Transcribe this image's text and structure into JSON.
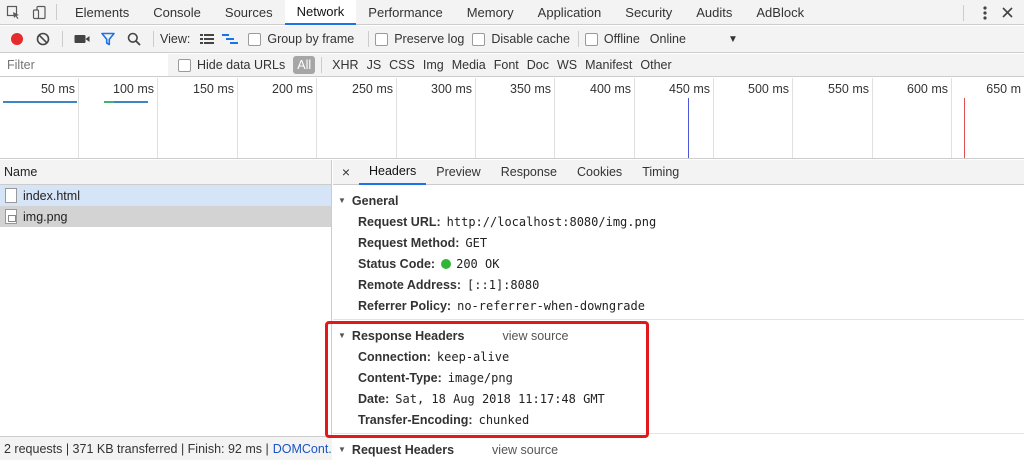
{
  "tabbar": {
    "tabs": [
      "Elements",
      "Console",
      "Sources",
      "Network",
      "Performance",
      "Memory",
      "Application",
      "Security",
      "Audits",
      "AdBlock"
    ],
    "active": "Network"
  },
  "toolbar": {
    "view_label": "View:",
    "group_by_frame": "Group by frame",
    "preserve_log": "Preserve log",
    "disable_cache": "Disable cache",
    "offline": "Offline",
    "throttle_value": "Online",
    "record_color": "#e52b2b",
    "filter_active_color": "#1a73e8"
  },
  "filter": {
    "placeholder": "Filter",
    "hide_data_urls": "Hide data URLs",
    "types": [
      "All",
      "XHR",
      "JS",
      "CSS",
      "Img",
      "Media",
      "Font",
      "Doc",
      "WS",
      "Manifest",
      "Other"
    ]
  },
  "overview": {
    "ticks": [
      "50 ms",
      "100 ms",
      "150 ms",
      "200 ms",
      "250 ms",
      "300 ms",
      "350 ms",
      "400 ms",
      "450 ms",
      "500 ms",
      "550 ms",
      "600 ms",
      "650 m"
    ]
  },
  "requests": {
    "header": "Name",
    "items": [
      "index.html",
      "img.png"
    ],
    "status_text": "2 requests | 371 KB transferred | Finish: 92 ms |",
    "status_link": "DOMCont..."
  },
  "details": {
    "tabs": [
      "Headers",
      "Preview",
      "Response",
      "Cookies",
      "Timing"
    ],
    "close_glyph": "×",
    "general": {
      "title": "General",
      "rows": [
        {
          "k": "Request URL:",
          "v": "http://localhost:8080/img.png"
        },
        {
          "k": "Request Method:",
          "v": "GET"
        },
        {
          "k": "Status Code:",
          "v": "200 OK"
        },
        {
          "k": "Remote Address:",
          "v": "[::1]:8080"
        },
        {
          "k": "Referrer Policy:",
          "v": "no-referrer-when-downgrade"
        }
      ]
    },
    "response_headers": {
      "title": "Response Headers",
      "view_source": "view source",
      "rows": [
        {
          "k": "Connection:",
          "v": "keep-alive"
        },
        {
          "k": "Content-Type:",
          "v": "image/png"
        },
        {
          "k": "Date:",
          "v": "Sat, 18 Aug 2018 11:17:48 GMT"
        },
        {
          "k": "Transfer-Encoding:",
          "v": "chunked"
        }
      ]
    },
    "request_headers": {
      "title": "Request Headers",
      "view_source": "view source"
    }
  }
}
